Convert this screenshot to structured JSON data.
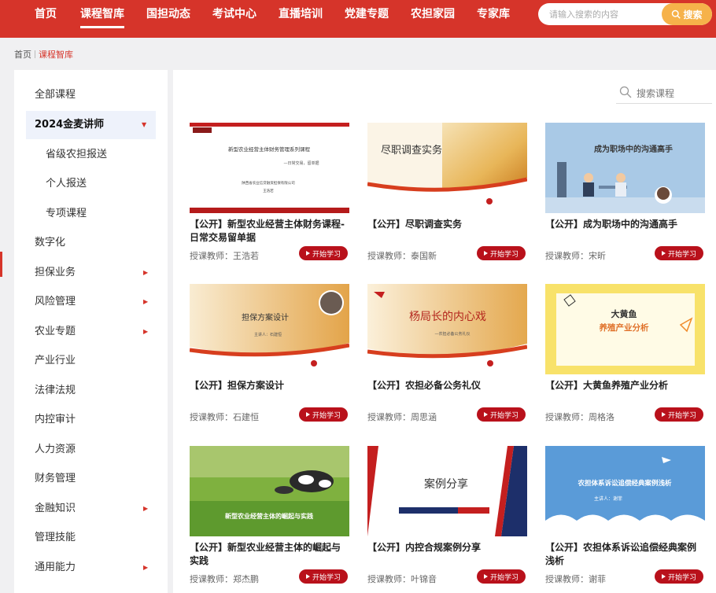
{
  "nav": {
    "items": [
      "首页",
      "课程智库",
      "国担动态",
      "考试中心",
      "直播培训",
      "党建专题",
      "农担家园",
      "专家库"
    ],
    "active_index": 1,
    "search_placeholder": "请输入搜索的内容",
    "search_button": "搜索"
  },
  "breadcrumb": {
    "home": "首页",
    "current": "课程智库"
  },
  "sidebar": {
    "items": [
      {
        "label": "全部课程"
      },
      {
        "label": "2024金麦讲师"
      },
      {
        "label": "省级农担报送"
      },
      {
        "label": "个人报送"
      },
      {
        "label": "专项课程"
      },
      {
        "label": "数字化"
      },
      {
        "label": "担保业务"
      },
      {
        "label": "风险管理"
      },
      {
        "label": "农业专题"
      },
      {
        "label": "产业行业"
      },
      {
        "label": "法律法规"
      },
      {
        "label": "内控审计"
      },
      {
        "label": "人力资源"
      },
      {
        "label": "财务管理"
      },
      {
        "label": "金融知识"
      },
      {
        "label": "管理技能"
      },
      {
        "label": "通用能力"
      },
      {
        "label": "¬¬¬¬"
      }
    ]
  },
  "course_search": {
    "label": "搜索课程"
  },
  "study_button_label": "开始学习",
  "colors": {
    "brand_red": "#d6342a",
    "button_red": "#b9111b",
    "search_orange": "#f6b24a"
  },
  "thumbnails": {
    "t1": {
      "title": "新型农业经营主体财务管理系列课程",
      "subtitle": "—日常交易，留单据",
      "org": "陕西省农业信贷融资担保有限公司",
      "name": "王浩若"
    },
    "t2": {
      "title": "尽职调查实务"
    },
    "t3": {
      "title": "成为职场中的沟通高手"
    },
    "t4": {
      "title": "担保方案设计",
      "presenter": "主讲人：石建恒"
    },
    "t5": {
      "title": "杨局长的内心戏",
      "subtitle": "—农担必备公务礼仪"
    },
    "t6": {
      "title": "大黄鱼",
      "subtitle": "养殖产业分析"
    },
    "t7": {
      "title": "新型农业经营主体的崛起与实践"
    },
    "t8": {
      "title": "案例分享"
    },
    "t9": {
      "title": "农担体系诉讼追偿经典案例浅析",
      "presenter": "主讲人：谢菲"
    }
  },
  "courses": [
    {
      "title": "【公开】新型农业经营主体财务课程-日常交易留单据",
      "teacher": "授课教师：王浩若"
    },
    {
      "title": "【公开】尽职调查实务",
      "teacher": "授课教师：泰国新"
    },
    {
      "title": "【公开】成为职场中的沟通高手",
      "teacher": "授课教师：宋昕"
    },
    {
      "title": "【公开】担保方案设计",
      "teacher": "授课教师：石建恒"
    },
    {
      "title": "【公开】农担必备公务礼仪",
      "teacher": "授课教师：周思涵"
    },
    {
      "title": "【公开】大黄鱼养殖产业分析",
      "teacher": "授课教师：周格洛"
    },
    {
      "title": "【公开】新型农业经营主体的崛起与实践",
      "teacher": "授课教师：郑杰鹏"
    },
    {
      "title": "【公开】内控合规案例分享",
      "teacher": "授课教师：叶锦音"
    },
    {
      "title": "【公开】农担体系诉讼追偿经典案例浅析",
      "teacher": "授课教师：谢菲"
    }
  ]
}
